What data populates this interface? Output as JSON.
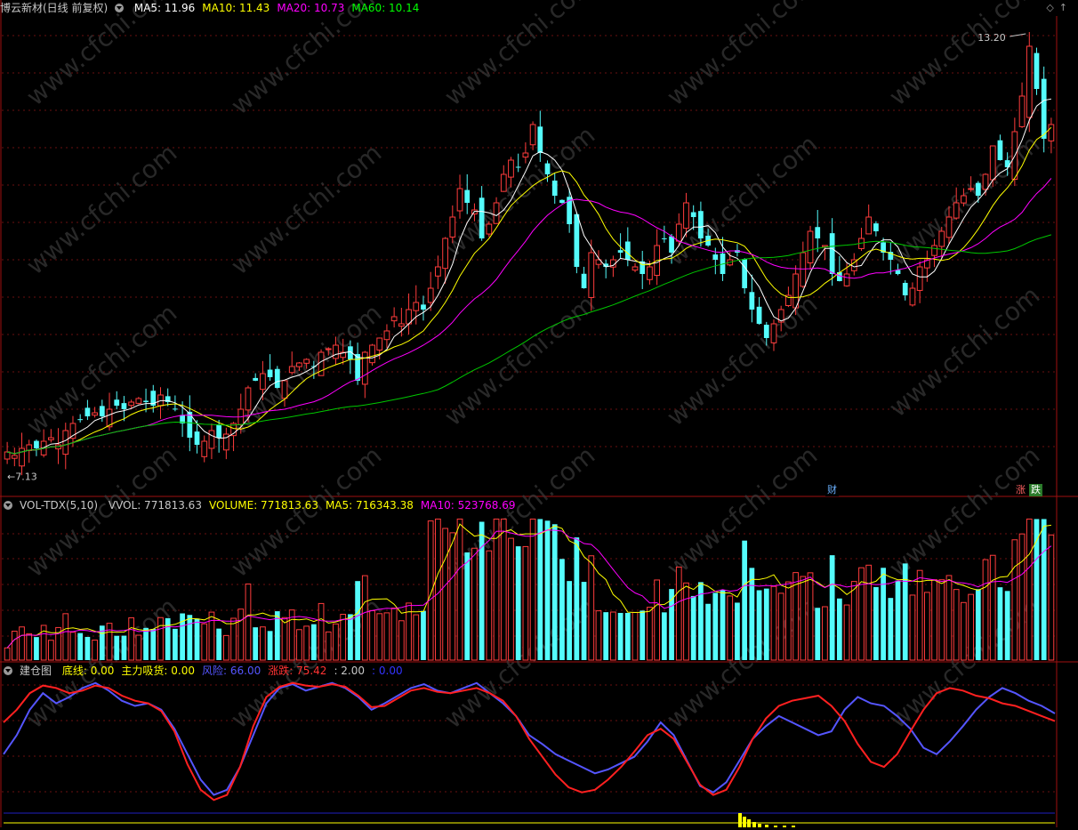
{
  "price_panel": {
    "title": "博云新材(日线 前复权)",
    "ma_legend": [
      {
        "label": "MA5: 11.96",
        "color": "#ffffff"
      },
      {
        "label": "MA10: 11.43",
        "color": "#ffff00"
      },
      {
        "label": "MA20: 10.73",
        "color": "#ff00ff"
      },
      {
        "label": "MA60: 10.14",
        "color": "#00ff00"
      }
    ],
    "high_label": "13.20",
    "low_label": "7.13",
    "badge_cai": "财",
    "badge_zhang": "涨",
    "badge_die": "跌"
  },
  "volume_panel": {
    "title": "VOL-TDX(5,10)",
    "legend": [
      {
        "label": "VVOL: 771813.63",
        "color": "#c8c8c8"
      },
      {
        "label": "VOLUME: 771813.63",
        "color": "#ffff00"
      },
      {
        "label": "MA5: 716343.38",
        "color": "#ffff00"
      },
      {
        "label": "MA10: 523768.69",
        "color": "#ff00ff"
      }
    ]
  },
  "indicator_panel": {
    "title": "建仓图",
    "legend": [
      {
        "label": "底线: 0.00",
        "color": "#ffff00"
      },
      {
        "label": "主力吸货: 0.00",
        "color": "#ffff00"
      },
      {
        "label": "风险: 66.00",
        "color": "#5555ff"
      },
      {
        "label": "涨跌: 75.42",
        "color": "#ff3333"
      },
      {
        "label": ": 2.00",
        "color": "#c8c8c8"
      },
      {
        "label": ": 0.00",
        "color": "#3333ff"
      }
    ]
  },
  "watermark": "www.cfchi.com",
  "colors": {
    "up": "#ff3c3c",
    "down": "#54fcfc",
    "ma5": "#ffffff",
    "ma10": "#ffff00",
    "ma20": "#ff00ff",
    "ma60": "#00c800",
    "risk": "#5555ff",
    "trend": "#ff2020"
  },
  "chart_data": [
    {
      "type": "candlestick",
      "title": "博云新材(日线 前复权)",
      "ylim": [
        6.9,
        13.4
      ],
      "bar_count": 144,
      "closes": [
        7.3,
        7.25,
        7.35,
        7.4,
        7.35,
        7.45,
        7.5,
        7.4,
        7.6,
        7.7,
        7.75,
        7.8,
        7.85,
        7.8,
        7.9,
        7.95,
        7.9,
        8.0,
        8.05,
        8.0,
        7.95,
        8.1,
        8.0,
        7.9,
        7.7,
        7.5,
        7.4,
        7.45,
        7.6,
        7.5,
        7.55,
        7.7,
        7.9,
        8.2,
        8.3,
        8.4,
        8.35,
        8.2,
        8.3,
        8.5,
        8.55,
        8.6,
        8.5,
        8.7,
        8.75,
        8.8,
        8.7,
        8.6,
        8.3,
        8.7,
        8.8,
        8.9,
        9.0,
        9.2,
        9.1,
        9.3,
        9.4,
        9.3,
        9.6,
        9.9,
        10.3,
        10.6,
        11.0,
        10.8,
        10.7,
        10.3,
        10.5,
        10.8,
        11.2,
        11.4,
        11.3,
        11.5,
        11.9,
        11.5,
        11.2,
        10.9,
        10.8,
        10.5,
        9.9,
        9.6,
        10.1,
        10.0,
        9.9,
        10.0,
        10.1,
        10.0,
        9.9,
        9.8,
        9.9,
        10.2,
        10.3,
        10.1,
        10.5,
        10.8,
        10.6,
        10.3,
        10.2,
        10.0,
        9.8,
        10.0,
        10.1,
        9.6,
        9.3,
        9.1,
        8.9,
        9.1,
        9.3,
        9.5,
        9.8,
        10.1,
        10.4,
        10.3,
        10.2,
        9.8,
        9.7,
        9.8,
        10.0,
        10.3,
        10.6,
        10.4,
        10.1,
        10.0,
        9.8,
        9.5,
        9.6,
        9.9,
        10.0,
        10.2,
        10.4,
        10.6,
        10.8,
        10.9,
        11.0,
        10.9,
        11.2,
        11.6,
        11.4,
        11.3,
        11.8,
        12.3,
        13.0,
        12.4,
        11.7,
        11.9
      ],
      "ma_series": [
        "MA5",
        "MA10",
        "MA20",
        "MA60"
      ]
    },
    {
      "type": "bar",
      "title": "VOL-TDX(5,10)",
      "ylim": [
        0,
        900000
      ],
      "last_value": 771813.63
    },
    {
      "type": "line",
      "title": "建仓图",
      "ylim": [
        0,
        100
      ],
      "series": [
        {
          "name": "风险",
          "values": [
            40,
            55,
            75,
            88,
            80,
            85,
            92,
            96,
            90,
            82,
            78,
            80,
            75,
            60,
            40,
            20,
            8,
            12,
            30,
            55,
            80,
            92,
            95,
            90,
            93,
            96,
            92,
            85,
            75,
            80,
            86,
            92,
            95,
            90,
            88,
            92,
            96,
            88,
            80,
            70,
            55,
            48,
            40,
            35,
            30,
            25,
            28,
            33,
            38,
            50,
            65,
            55,
            35,
            15,
            10,
            18,
            35,
            52,
            62,
            70,
            65,
            60,
            55,
            58,
            75,
            85,
            80,
            78,
            70,
            60,
            45,
            40,
            50,
            62,
            75,
            85,
            92,
            88,
            82,
            78,
            72
          ]
        },
        {
          "name": "涨跌",
          "values": [
            65,
            75,
            88,
            94,
            92,
            88,
            90,
            94,
            92,
            86,
            82,
            80,
            74,
            58,
            32,
            12,
            4,
            8,
            30,
            62,
            85,
            93,
            96,
            94,
            93,
            95,
            93,
            86,
            77,
            78,
            84,
            90,
            92,
            89,
            88,
            90,
            92,
            88,
            82,
            70,
            52,
            38,
            24,
            14,
            10,
            12,
            20,
            30,
            42,
            55,
            60,
            52,
            34,
            16,
            8,
            12,
            30,
            52,
            68,
            78,
            82,
            84,
            86,
            78,
            66,
            48,
            34,
            30,
            40,
            58,
            75,
            88,
            92,
            90,
            86,
            84,
            80,
            78,
            74,
            70,
            66
          ]
        }
      ]
    }
  ]
}
